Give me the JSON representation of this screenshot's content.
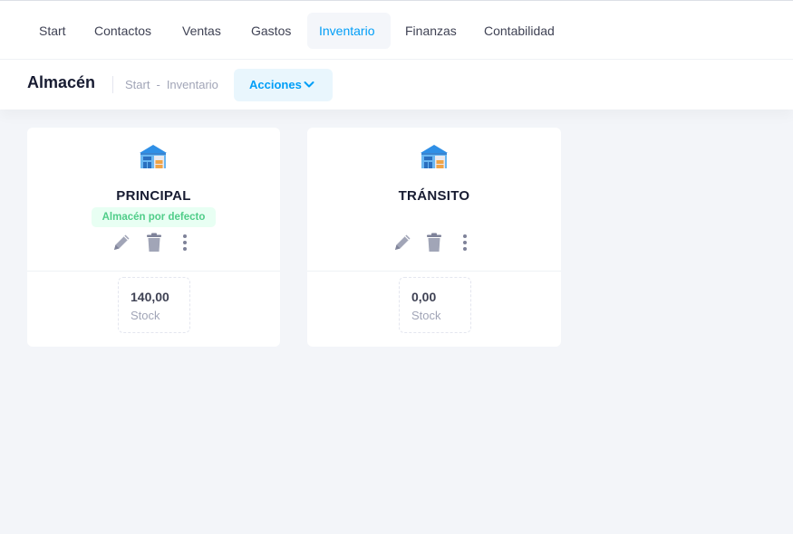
{
  "nav": {
    "items": [
      {
        "label": "Start"
      },
      {
        "label": "Contactos"
      },
      {
        "label": "Ventas"
      },
      {
        "label": "Gastos"
      },
      {
        "label": "Inventario",
        "active": true
      },
      {
        "label": "Finanzas"
      },
      {
        "label": "Contabilidad"
      }
    ]
  },
  "subheader": {
    "title": "Almacén",
    "breadcrumb": [
      "Start",
      "Inventario"
    ],
    "breadcrumb_separator": "-",
    "actions_label": "Acciones"
  },
  "warehouses": [
    {
      "name": "PRINCIPAL",
      "badge": "Almacén por defecto",
      "stock_value": "140,00",
      "stock_label": "Stock",
      "icons": [
        "warehouse-icon",
        "pencil-icon",
        "trash-icon",
        "more-vertical-icon"
      ]
    },
    {
      "name": "TRÁNSITO",
      "stock_value": "0,00",
      "stock_label": "Stock",
      "icons": [
        "warehouse-icon",
        "pencil-icon",
        "trash-icon",
        "more-vertical-icon"
      ]
    }
  ],
  "colors": {
    "accent": "#009ef7",
    "accent_light": "#e9f6fd",
    "success": "#50cd89",
    "success_light": "#e8fff3",
    "page_bg": "#f3f5f9"
  }
}
